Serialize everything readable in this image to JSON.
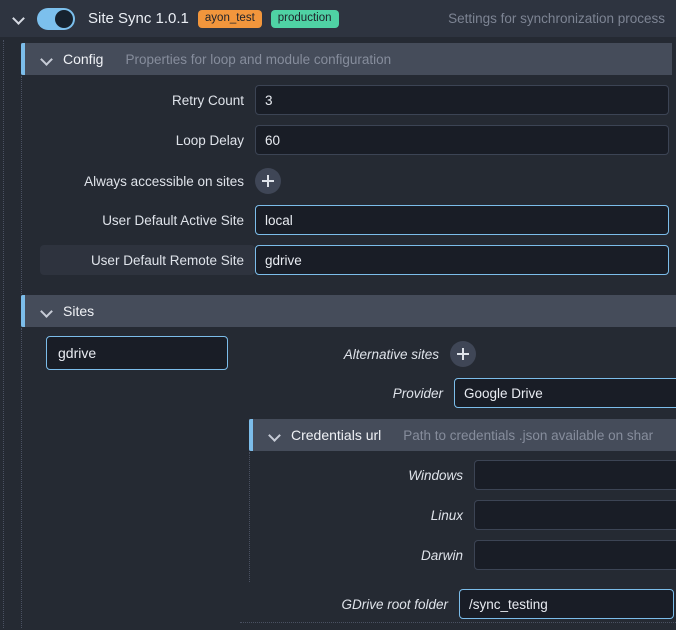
{
  "titlebar": {
    "expand_icon": "chevron-down-icon",
    "toggle_state": "on",
    "title": "Site Sync 1.0.1",
    "badges": [
      {
        "label": "ayon_test",
        "color": "#f2963c"
      },
      {
        "label": "production",
        "color": "#4fd2a4"
      }
    ],
    "hint": "Settings for synchronization process"
  },
  "config_section": {
    "title": "Config",
    "hint": "Properties for loop and module configuration",
    "accent_color": "#7cbdea",
    "fields": {
      "retry_count": {
        "label": "Retry Count",
        "value": "3"
      },
      "loop_delay": {
        "label": "Loop Delay",
        "value": "60"
      },
      "always_accessible": {
        "label": "Always accessible on sites",
        "add_label": "+"
      },
      "default_active_site": {
        "label": "User Default Active Site",
        "value": "local"
      },
      "default_remote_site": {
        "label": "User Default Remote Site",
        "value": "gdrive"
      }
    }
  },
  "sites_section": {
    "title": "Sites",
    "hint": "",
    "accent_color": "#7cbdea",
    "site_name": "gdrive",
    "alternative_sites": {
      "label": "Alternative sites",
      "add_label": "+"
    },
    "provider": {
      "label": "Provider",
      "value": "Google Drive"
    },
    "credentials": {
      "title": "Credentials url",
      "hint": "Path to credentials .json available on shar",
      "accent_color": "#7cbdea",
      "windows": {
        "label": "Windows",
        "value": ""
      },
      "linux": {
        "label": "Linux",
        "value": ""
      },
      "darwin": {
        "label": "Darwin",
        "value": ""
      }
    },
    "gdrive_root": {
      "label": "GDrive root folder",
      "value": "/sync_testing"
    }
  }
}
